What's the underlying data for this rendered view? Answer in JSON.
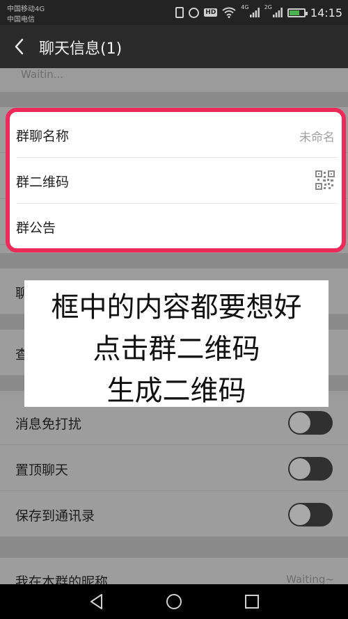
{
  "status_bar": {
    "carrier_1": "中国移动4G",
    "carrier_2": "中国电信",
    "hd_badge": "HD",
    "network_1": "4G",
    "network_2": "2G",
    "time": "14:15",
    "battery_level": 0.7,
    "battery_color": "#4caf50"
  },
  "header": {
    "back_icon": "chevron-left-icon",
    "title": "聊天信息(1)"
  },
  "top_partial": {
    "text": "Waitin..."
  },
  "highlight_card": {
    "border_color": "#ee2a5b",
    "rows": [
      {
        "label": "群聊名称",
        "value": "未命名"
      },
      {
        "label": "群二维码",
        "icon": "qr-code-icon"
      },
      {
        "label": "群公告"
      }
    ]
  },
  "behind_rows": {
    "partial_1": "聊",
    "partial_2": "查"
  },
  "caption": {
    "lines": [
      "框中的内容都要想好",
      "点击群二维码",
      "生成二维码"
    ]
  },
  "settings": {
    "toggles": [
      {
        "label": "消息免打扰",
        "on": false
      },
      {
        "label": "置顶聊天",
        "on": false
      },
      {
        "label": "保存到通讯录",
        "on": false
      }
    ]
  },
  "bottom_partial": {
    "label": "我在本群的昵称",
    "value": "Waiting~"
  },
  "nav": {
    "back": "nav-back-icon",
    "home": "nav-home-icon",
    "recents": "nav-recents-icon"
  }
}
